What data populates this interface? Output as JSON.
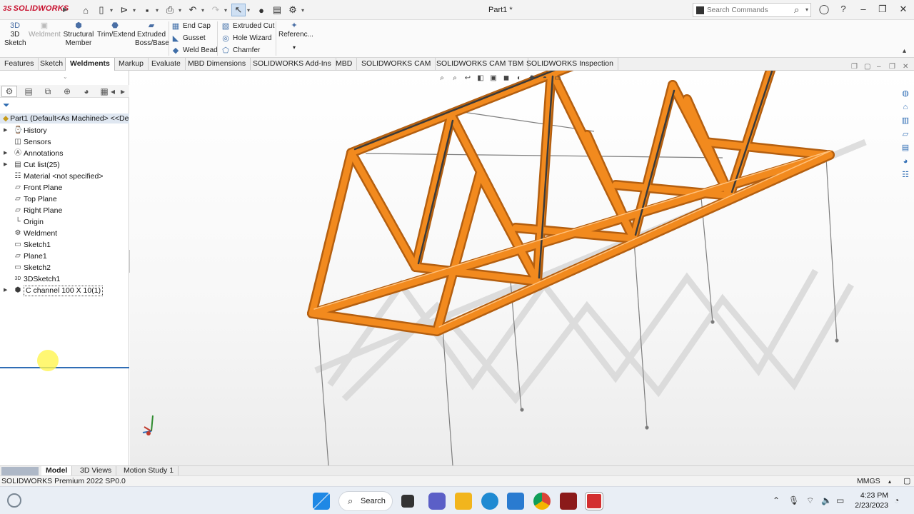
{
  "app": {
    "logo": "SOLIDWORKS",
    "document_title": "Part1 *",
    "search_placeholder": "Search Commands"
  },
  "command_manager": {
    "sketch3d": "3D\nSketch",
    "weldment": "Weldment",
    "structural_member": "Structural\nMember",
    "trim_extend": "Trim/Extend",
    "extruded_boss": "Extruded\nBoss/Base",
    "end_cap": "End Cap",
    "gusset": "Gusset",
    "weld_bead": "Weld Bead",
    "extruded_cut": "Extruded Cut",
    "hole_wizard": "Hole Wizard",
    "chamfer": "Chamfer",
    "reference": "Referenc..."
  },
  "tabs": [
    "Features",
    "Sketch",
    "Weldments",
    "Markup",
    "Evaluate",
    "MBD Dimensions",
    "SOLIDWORKS Add-Ins",
    "MBD",
    "SOLIDWORKS CAM",
    "SOLIDWORKS CAM TBM",
    "SOLIDWORKS Inspection"
  ],
  "active_tab": "Weldments",
  "feature_tree": {
    "root": "Part1 (Default<As Machined> <<De",
    "items": [
      {
        "label": "History",
        "icon": "history-icon",
        "expandable": true
      },
      {
        "label": "Sensors",
        "icon": "sensors-icon",
        "expandable": false
      },
      {
        "label": "Annotations",
        "icon": "annotations-icon",
        "expandable": true
      },
      {
        "label": "Cut list(25)",
        "icon": "cut-list-icon",
        "expandable": true
      },
      {
        "label": "Material <not specified>",
        "icon": "material-icon",
        "expandable": false
      },
      {
        "label": "Front Plane",
        "icon": "plane-icon",
        "expandable": false
      },
      {
        "label": "Top Plane",
        "icon": "plane-icon",
        "expandable": false
      },
      {
        "label": "Right Plane",
        "icon": "plane-icon",
        "expandable": false
      },
      {
        "label": "Origin",
        "icon": "origin-icon",
        "expandable": false
      },
      {
        "label": "Weldment",
        "icon": "weldment-icon",
        "expandable": false
      },
      {
        "label": "Sketch1",
        "icon": "sketch-icon",
        "expandable": false
      },
      {
        "label": "Plane1",
        "icon": "plane-icon",
        "expandable": false
      },
      {
        "label": "Sketch2",
        "icon": "sketch-icon",
        "expandable": false
      },
      {
        "label": "3DSketch1",
        "icon": "sketch3d-icon",
        "expandable": false
      },
      {
        "label": "C channel 100 X 10(1)",
        "icon": "structural-member-icon",
        "expandable": true
      }
    ]
  },
  "bottom_tabs": [
    "Model",
    "3D Views",
    "Motion Study 1"
  ],
  "active_bottom_tab": "Model",
  "status": {
    "text": "SOLIDWORKS Premium 2022 SP0.0",
    "units": "MMGS"
  },
  "taskbar": {
    "search_label": "Search",
    "time": "4:23 PM",
    "date": "2/23/2023"
  },
  "colors": {
    "member_orange": "#f28a1e",
    "selection_blue": "#2f6db5",
    "brand_red": "#c8102e"
  }
}
